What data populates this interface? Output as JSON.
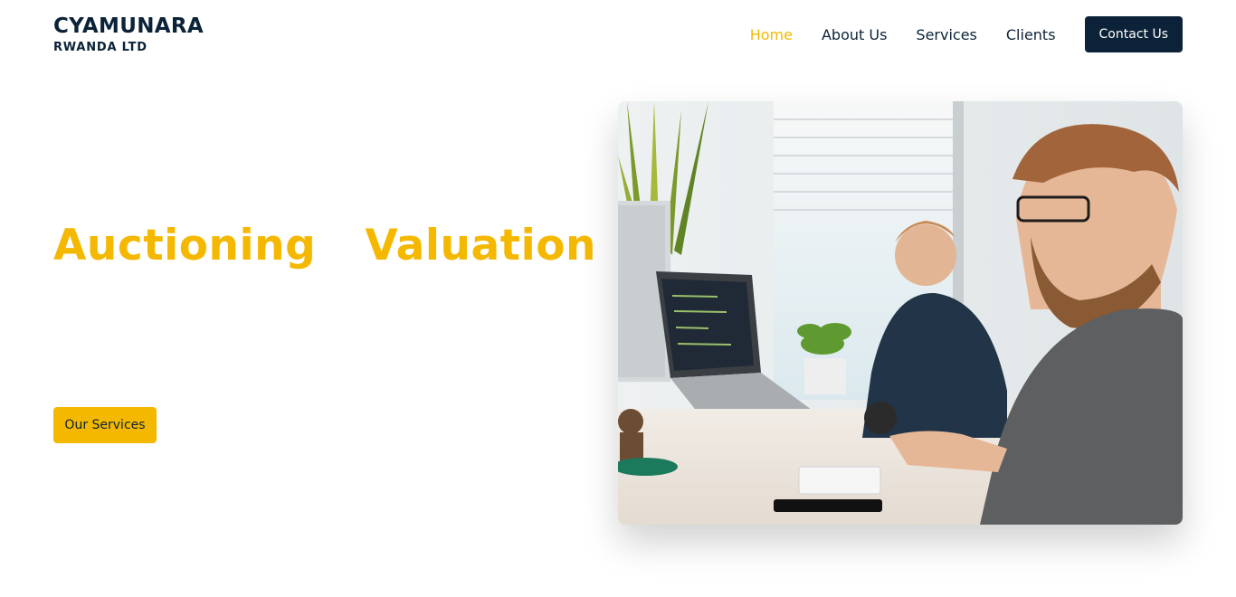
{
  "brand": {
    "name": "CYAMUNARA",
    "subtitle": "RWANDA LTD"
  },
  "nav": {
    "items": [
      {
        "label": "Home",
        "active": true
      },
      {
        "label": "About Us",
        "active": false
      },
      {
        "label": "Services",
        "active": false
      },
      {
        "label": "Clients",
        "active": false
      }
    ],
    "contact_label": "Contact Us"
  },
  "hero": {
    "words": [
      "Auctioning",
      "Valuation"
    ],
    "cta_label": "Our Services",
    "image_icon": "office-workers-photo"
  },
  "colors": {
    "accent": "#f5b800",
    "navy": "#0b2238",
    "background": "#ffffff"
  }
}
